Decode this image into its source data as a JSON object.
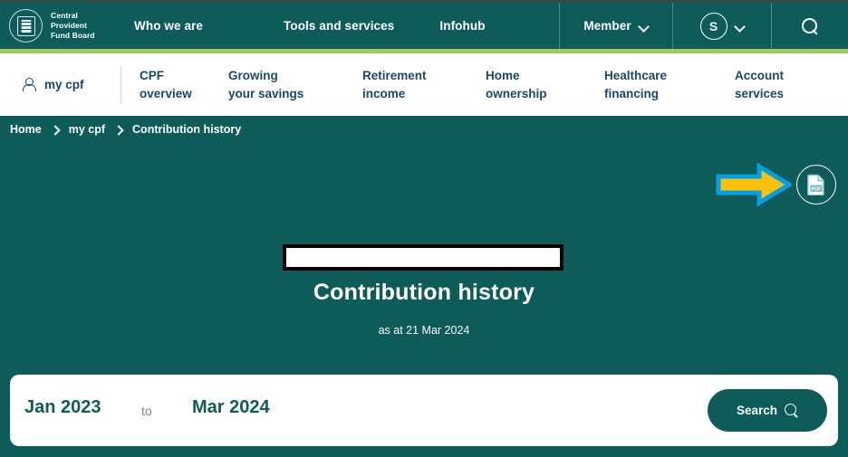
{
  "colors": {
    "teal": "#0d5c5a",
    "green_accent": "#a0ca5a",
    "navy_text": "#17496b",
    "arrow_fill": "#ffc107",
    "arrow_outline": "#00a0e9",
    "white": "#ffffff"
  },
  "header": {
    "brand": {
      "icon": "cpf-seal-icon",
      "line1": "Central",
      "line2": "Provident",
      "line3": "Fund Board"
    },
    "nav": [
      {
        "label": "Who we are"
      },
      {
        "label": "Tools and services"
      },
      {
        "label": "Infohub"
      }
    ],
    "member": {
      "label": "Member",
      "chevron_icon": "chevron-down-icon"
    },
    "user": {
      "initial": "S",
      "chevron_icon": "chevron-down-icon"
    },
    "search_icon": "search-icon"
  },
  "subnav": {
    "mycpf": {
      "icon": "person-icon",
      "label": "my cpf"
    },
    "items": [
      {
        "label": "CPF\noverview"
      },
      {
        "label": "Growing\nyour savings"
      },
      {
        "label": "Retirement\nincome"
      },
      {
        "label": "Home\nownership"
      },
      {
        "label": "Healthcare\nfinancing"
      },
      {
        "label": "Account\nservices"
      }
    ]
  },
  "breadcrumb": {
    "items": [
      {
        "label": "Home"
      },
      {
        "label": "my cpf"
      },
      {
        "label": "Contribution history"
      }
    ],
    "separator_icon": "chevron-right-icon"
  },
  "actions": {
    "download_pdf": {
      "icon": "pdf-document-icon",
      "badge_text": "PDF"
    },
    "annotation_arrow": {
      "icon": "right-arrow-annotation-icon"
    }
  },
  "hero": {
    "redacted_field": "",
    "title": "Contribution history",
    "subtitle": "as at 21 Mar 2024"
  },
  "search_panel": {
    "date_from": "Jan 2023",
    "to_label": "to",
    "date_until": "Mar 2024",
    "search_label": "Search",
    "search_icon": "search-icon"
  }
}
